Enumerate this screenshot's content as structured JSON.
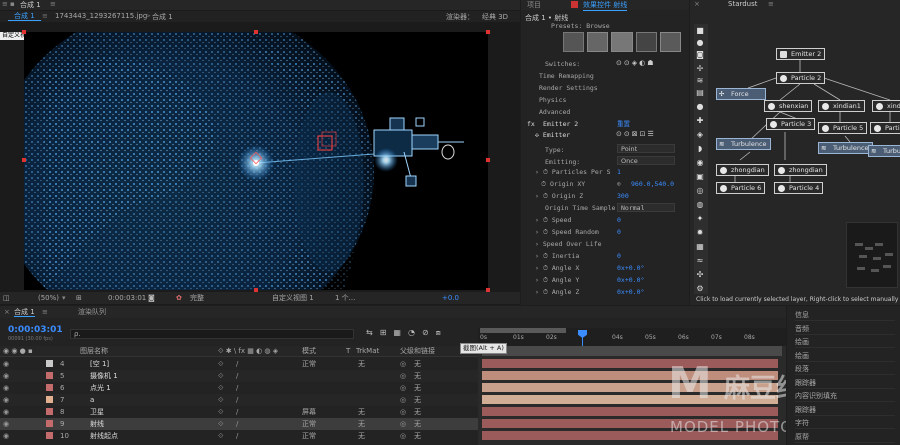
{
  "comp_panel": {
    "tab_main": "合成 1",
    "tab_pills": [
      "合成 1",
      "1743443_1293267115.jpg",
      "合成 1"
    ],
    "view_label": "自定义视图1",
    "renderer": "渲染器：",
    "renderer_value": "经典 3D",
    "zoom": "(50%)",
    "timecode": "0:00:03:01",
    "quality": "完整",
    "view_select": "自定义视图 1",
    "view_count": "1 个...",
    "exposure": "+0.0"
  },
  "effects_panel": {
    "tab_label": "效果控件 射线",
    "title": "合成 1 • 射线",
    "presets": "Presets: Browse",
    "switches": "Switches:",
    "sections": [
      "Time Remapping",
      "Render Settings",
      "Physics",
      "Advanced"
    ],
    "emitter_header": "Emitter 2",
    "reset_label": "重置",
    "emitter_sub": "Emitter",
    "type_label": "Type:",
    "type_value": "Point",
    "emitting_label": "Emitting:",
    "emitting_value": "Once",
    "rows": [
      {
        "label": "Particles Per S",
        "value": "1"
      },
      {
        "label": "Origin XY",
        "value": "960.0,540.0"
      },
      {
        "label": "Origin Z",
        "value": "300"
      },
      {
        "label": "Origin Time Sample",
        "value": "Normal"
      },
      {
        "label": "Speed",
        "value": "0"
      },
      {
        "label": "Speed Random",
        "value": "0"
      },
      {
        "label": "Speed Over Life",
        "value": ""
      },
      {
        "label": "Inertia",
        "value": "0"
      },
      {
        "label": "Angle X",
        "value": "0x+0.0°"
      },
      {
        "label": "Angle Y",
        "value": "0x+0.0°"
      },
      {
        "label": "Angle Z",
        "value": "0x+0.0°"
      }
    ]
  },
  "stardust": {
    "title": "Stardust",
    "nodes": {
      "emitter2": "Emitter 2",
      "particle2": "Particle 2",
      "force": "Force",
      "shenxian": "shenxian",
      "xindian1": "xindian1",
      "xindi": "xindi",
      "particle3": "Particle 3",
      "particle5": "Particle 5",
      "particle": "Particle",
      "turbulence1": "Turbulence",
      "turbulence2": "Turbulence",
      "turbu": "Turbu",
      "zhongdian1": "zhongdian",
      "zhongdian2": "zhongdian",
      "particle6": "Particle 6",
      "particle4": "Particle 4"
    },
    "status": "Click to load currently selected layer, Right-click to select manually"
  },
  "timeline": {
    "tab1": "合成 1",
    "tab2": "渲染队列",
    "timecode": "0:00:03:01",
    "timecode_sub": "00091 (30.00 fps)",
    "search_placeholder": "ρ.",
    "col_name": "图层名称",
    "col_mode": "模式",
    "col_t": "T",
    "col_trkmat": "TrkMat",
    "col_parent": "父级和链接",
    "ruler": [
      "0s",
      "01s",
      "02s",
      "",
      "04s",
      "05s",
      "06s",
      "07s",
      "08s"
    ],
    "tooltip": "截图(Alt + A)",
    "layers": [
      {
        "num": "4",
        "name": "[空 1]",
        "mode": "正常",
        "trk": "无",
        "parent": "无",
        "color": "#c9c9c9"
      },
      {
        "num": "5",
        "name": "摄像机 1",
        "mode": "",
        "trk": "",
        "parent": "无",
        "color": "#c46b6b"
      },
      {
        "num": "6",
        "name": "点光 1",
        "mode": "",
        "trk": "",
        "parent": "无",
        "color": "#c46b6b"
      },
      {
        "num": "7",
        "name": "a",
        "mode": "",
        "trk": "",
        "parent": "无",
        "color": "#e0b090"
      },
      {
        "num": "8",
        "name": "卫星",
        "mode": "屏幕",
        "trk": "无",
        "parent": "无",
        "color": "#c46b6b"
      },
      {
        "num": "9",
        "name": "射线",
        "mode": "正常",
        "trk": "无",
        "parent": "无",
        "color": "#c46b6b"
      },
      {
        "num": "10",
        "name": "射线起点",
        "mode": "正常",
        "trk": "无",
        "parent": "无",
        "color": "#c46b6b"
      }
    ]
  },
  "right_panel": {
    "items": [
      "信息",
      "音频",
      "绘画",
      "绘画",
      "段落",
      "跟踪器",
      "内容识别填充",
      "跟踪器",
      "字符",
      "原帮"
    ]
  },
  "watermark": {
    "letter": "M",
    "text": "麻豆约拍",
    "sub": "MODEL PHOTOGRAPH"
  }
}
